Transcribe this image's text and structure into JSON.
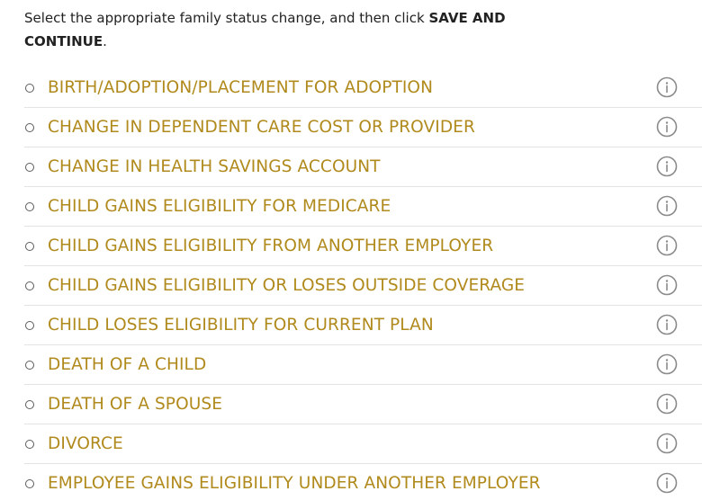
{
  "instructions": {
    "prefix": "Select the appropriate family status change, and then click ",
    "emphasis": "SAVE AND CONTINUE",
    "suffix": "."
  },
  "colors": {
    "option_label": "#b08a1c",
    "info_icon": "#8a8a8a",
    "divider": "#e3e3e3"
  },
  "options": [
    {
      "label": "BIRTH/ADOPTION/PLACEMENT FOR ADOPTION",
      "info_icon": "info-circle"
    },
    {
      "label": "CHANGE IN DEPENDENT CARE COST OR PROVIDER",
      "info_icon": "info-circle"
    },
    {
      "label": "CHANGE IN HEALTH SAVINGS ACCOUNT",
      "info_icon": "info-circle"
    },
    {
      "label": "CHILD GAINS ELIGIBILITY FOR MEDICARE",
      "info_icon": "info-circle"
    },
    {
      "label": "CHILD GAINS ELIGIBILITY FROM ANOTHER EMPLOYER",
      "info_icon": "info-circle"
    },
    {
      "label": "CHILD GAINS ELIGIBILITY OR LOSES OUTSIDE COVERAGE",
      "info_icon": "info-circle"
    },
    {
      "label": "CHILD LOSES ELIGIBILITY FOR CURRENT PLAN",
      "info_icon": "info-circle"
    },
    {
      "label": "DEATH OF A CHILD",
      "info_icon": "info-circle"
    },
    {
      "label": "DEATH OF A SPOUSE",
      "info_icon": "info-circle"
    },
    {
      "label": "DIVORCE",
      "info_icon": "info-circle"
    },
    {
      "label": "EMPLOYEE GAINS ELIGIBILITY UNDER ANOTHER EMPLOYER",
      "info_icon": "info-circle"
    }
  ]
}
